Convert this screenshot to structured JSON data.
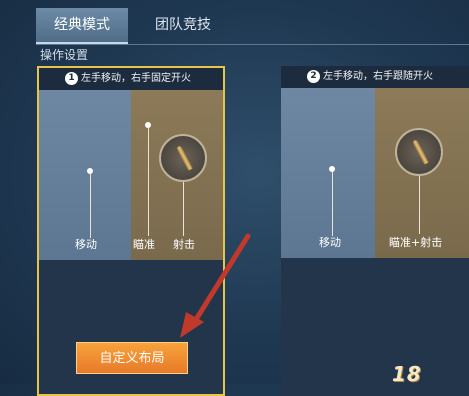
{
  "tabs": [
    {
      "label": "经典模式",
      "active": true
    },
    {
      "label": "团队竞技",
      "active": false
    }
  ],
  "section_title": "操作设置",
  "options": [
    {
      "number": "1",
      "description": "左手移动，右手固定开火",
      "selected": true,
      "labels": {
        "move": "移动",
        "aim": "瞄准",
        "fire": "射击"
      }
    },
    {
      "number": "2",
      "description": "左手移动，右手跟随开火",
      "selected": false,
      "labels": {
        "move": "移动",
        "aim_fire": "瞄准+射击"
      }
    }
  ],
  "custom_layout_button": "自定义布局",
  "watermark": "18",
  "colors": {
    "selected_border": "#e7c44a",
    "custom_button": "#f08f32",
    "arrow": "#c0392b"
  },
  "icons": {
    "fire": "bullet-icon",
    "pointer": "red-arrow-icon"
  }
}
